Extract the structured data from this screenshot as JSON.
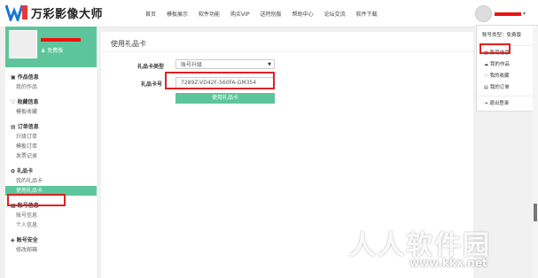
{
  "brand": {
    "name": "万彩影像大师",
    "accent_color": "#5cc59b",
    "logo_colors": [
      "#1976d2",
      "#e53935"
    ]
  },
  "nav": {
    "items": [
      "首页",
      "模板展示",
      "软件功能",
      "购买VIP",
      "送特别版",
      "帮助中心",
      "论坛交流",
      "软件下载"
    ]
  },
  "sidebar": {
    "member_label": "免费版",
    "sections": [
      {
        "title": "作品信息",
        "icon": "image-icon",
        "items": [
          "我的作品"
        ]
      },
      {
        "title": "收藏信息",
        "icon": "heart-icon",
        "items": [
          "模板收藏"
        ]
      },
      {
        "title": "订单信息",
        "icon": "cart-icon",
        "items": [
          "升级订单",
          "模板订单",
          "发票记录"
        ]
      },
      {
        "title": "礼品卡",
        "icon": "gift-icon",
        "items": [
          "我的礼品卡",
          "使用礼品卡"
        ]
      },
      {
        "title": "账号信息",
        "icon": "id-card-icon",
        "items": [
          "账号信息",
          "个人信息"
        ]
      },
      {
        "title": "账号安全",
        "icon": "lock-icon",
        "items": [
          "修改邮箱"
        ]
      }
    ],
    "active_item": "使用礼品卡"
  },
  "main": {
    "title": "使用礼品卡",
    "card_type_label": "礼品卡类型",
    "card_type_value": "账号升级",
    "card_number_label": "礼品卡号",
    "card_number_value": "7289Z-VD42F-560FA-GM354",
    "submit_label": "使用礼品卡"
  },
  "dropdown": {
    "account_type": "账号类型：免费版",
    "items": [
      {
        "label": "账号信息",
        "icon": "id-card-icon"
      },
      {
        "label": "我的作品",
        "icon": "cloud-icon"
      },
      {
        "label": "我的收藏",
        "icon": "heart-icon"
      },
      {
        "label": "我的订单",
        "icon": "cart-icon"
      }
    ],
    "logout_label": "退出登录"
  },
  "watermark": {
    "text": "人人软件园",
    "url": "www.kkx.net"
  }
}
